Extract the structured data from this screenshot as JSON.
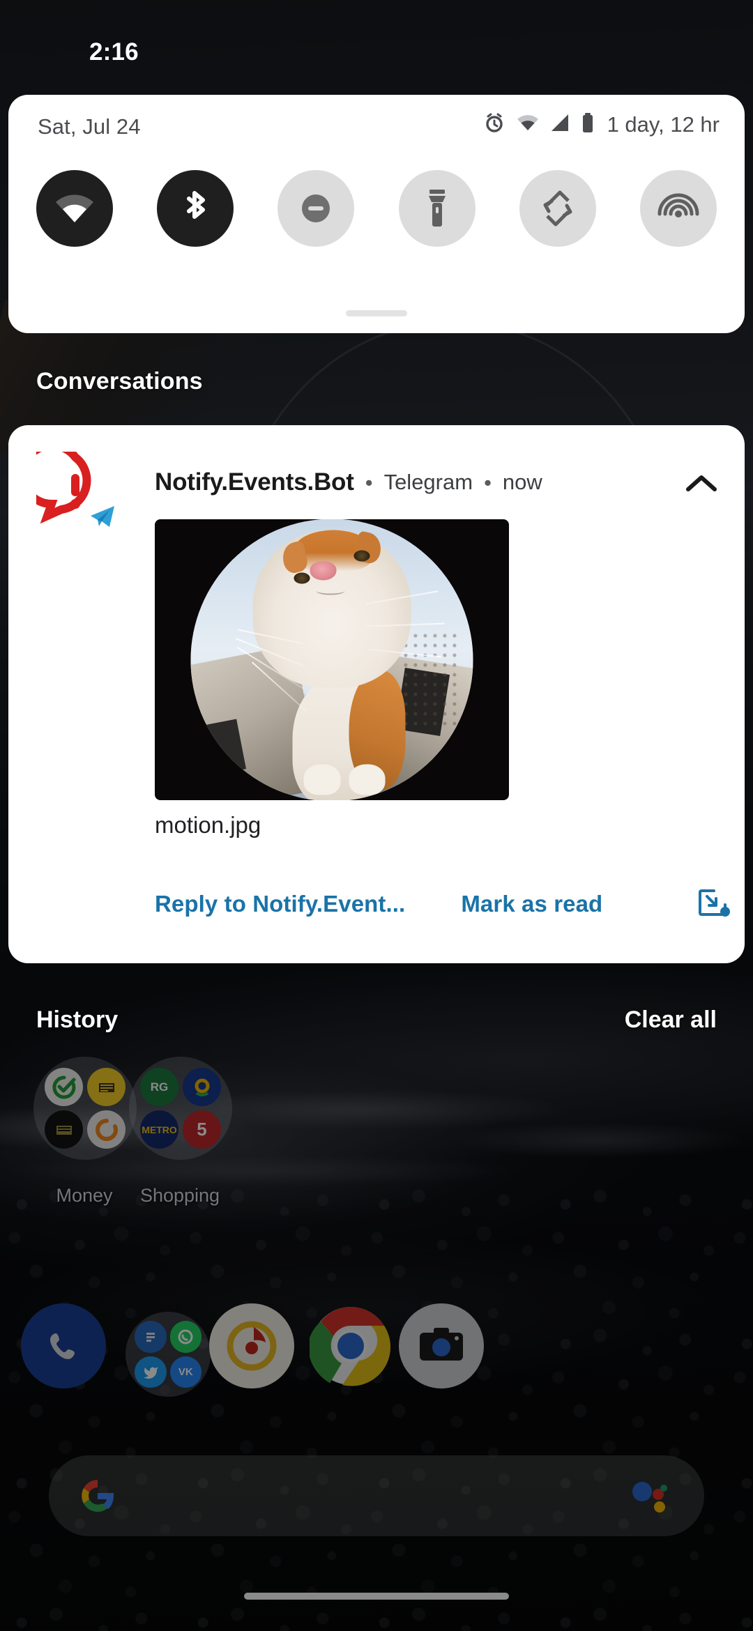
{
  "statusbar": {
    "clock": "2:16"
  },
  "quick_settings": {
    "date": "Sat, Jul 24",
    "battery_text": "1 day, 12 hr",
    "status_icons": [
      "alarm-icon",
      "wifi-icon",
      "cellular-signal-icon",
      "battery-icon"
    ],
    "tiles": [
      {
        "name": "wifi",
        "icon": "wifi-icon",
        "state": "on"
      },
      {
        "name": "bluetooth",
        "icon": "bluetooth-icon",
        "state": "on"
      },
      {
        "name": "do-not-disturb",
        "icon": "dnd-icon",
        "state": "off"
      },
      {
        "name": "flashlight",
        "icon": "flashlight-icon",
        "state": "off"
      },
      {
        "name": "auto-rotate",
        "icon": "auto-rotate-icon",
        "state": "off"
      },
      {
        "name": "hotspot",
        "icon": "hotspot-icon",
        "state": "off"
      }
    ],
    "handle": "drag-handle"
  },
  "conversations": {
    "section_title": "Conversations",
    "notification": {
      "app_name": "Notify.Events.Bot",
      "source": "Telegram",
      "time": "now",
      "separator": "•",
      "icon": "notify-events-alert-icon",
      "badge_icon": "telegram-badge-icon",
      "collapse_icon": "chevron-up-icon",
      "image_alt": "fisheye photo of an orange and white cat",
      "filename": "motion.jpg",
      "actions": [
        {
          "label": "Reply to Notify.Event...",
          "name": "reply-action"
        },
        {
          "label": "Mark as read",
          "name": "mark-as-read-action"
        }
      ],
      "bubble_icon": "open-bubble-icon",
      "accent_color": "#1a73a8"
    }
  },
  "history": {
    "label": "History",
    "clear_all": "Clear all"
  },
  "homescreen": {
    "folders": [
      {
        "label": "Money",
        "apps": [
          "sberbank-icon",
          "tinkoff-icon",
          "vtb-icon",
          "raiffeisen-icon"
        ]
      },
      {
        "label": "Shopping",
        "apps": [
          "rg-icon",
          "ozon-icon",
          "metro-icon",
          "pyaterochka-icon"
        ]
      }
    ],
    "folder_app_labels": {
      "rg": "RG",
      "metro": "METRO",
      "pyaterochka": "5"
    },
    "dock": [
      {
        "name": "phone-icon",
        "label": "Phone"
      },
      {
        "name": "social-folder",
        "label": "Social"
      },
      {
        "name": "music-icon",
        "label": "Music"
      },
      {
        "name": "chrome-icon",
        "label": "Chrome"
      },
      {
        "name": "camera-icon",
        "label": "Camera"
      }
    ],
    "search": {
      "logo": "google-g-icon",
      "assistant": "google-assistant-icon"
    },
    "nav": "gesture-nav-pill"
  },
  "colors": {
    "card_background": "#ffffff",
    "tile_on": "#1f1f1f",
    "tile_off": "#dcdcdc",
    "accent_blue": "#1a73a8",
    "text_primary": "#1a1a1a",
    "text_secondary": "#4a4c50"
  }
}
